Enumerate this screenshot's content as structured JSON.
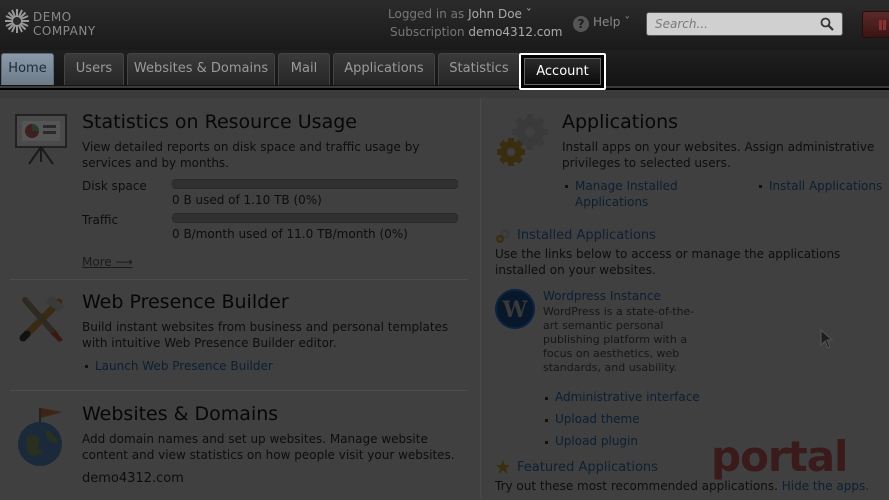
{
  "header": {
    "logo_line1": "DEMO",
    "logo_line2": "COMPANY",
    "logged_in_label": "Logged in as",
    "user_name": "John Doe",
    "subscription_label": "Subscription",
    "subscription_value": "demo4312.com",
    "help_label": "Help",
    "search_placeholder": "Search..."
  },
  "tabs": [
    {
      "label": "Home",
      "active": true
    },
    {
      "label": "Users"
    },
    {
      "label": "Websites & Domains"
    },
    {
      "label": "Mail"
    },
    {
      "label": "Applications"
    },
    {
      "label": "Statistics"
    },
    {
      "label": "Account",
      "highlighted": true
    }
  ],
  "stats": {
    "title": "Statistics on Resource Usage",
    "desc": "View detailed reports on disk space and traffic usage by services and by months.",
    "disk_label": "Disk space",
    "disk_value": "0 B used of 1.10 TB (0%)",
    "disk_percent": 0,
    "traffic_label": "Traffic",
    "traffic_value": "0 B/month used of 11.0 TB/month (0%)",
    "traffic_percent": 0,
    "more_label": "More ⟶"
  },
  "builder": {
    "title": "Web Presence Builder",
    "desc": "Build instant websites from business and personal templates with intuitive Web Presence Builder editor.",
    "launch_link": "Launch Web Presence Builder"
  },
  "websites": {
    "title": "Websites & Domains",
    "desc": "Add domain names and set up websites. Manage website content and view statistics on how people visit your websites.",
    "domain": "demo4312.com"
  },
  "applications": {
    "title": "Applications",
    "desc": "Install apps on your websites. Assign administrative privileges to selected users.",
    "manage_link": "Manage Installed Applications",
    "install_link": "Install Applications",
    "installed_heading": "Installed Applications",
    "installed_desc": "Use the links below to access or manage the applications installed on your websites.",
    "wp_name": "Wordpress Instance",
    "wp_desc": "WordPress is a state-of-the-art semantic personal publishing platform with a focus on aesthetics, web standards, and usability.",
    "wp_links": [
      "Administrative interface",
      "Upload theme",
      "Upload plugin"
    ],
    "featured_heading": "Featured Applications",
    "featured_desc": "Try out these most recommended applications.",
    "hide_link": "Hide the apps."
  },
  "watermark": "portal"
}
